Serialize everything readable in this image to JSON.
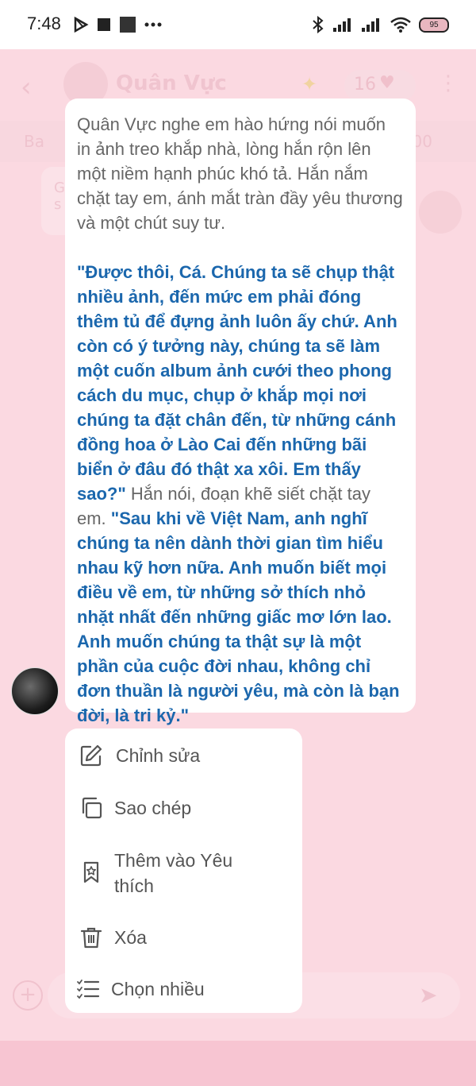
{
  "status_bar": {
    "time": "7:48",
    "battery": "95",
    "left_icons": [
      "play-store-icon",
      "square-icon",
      "square-icon",
      "more-dots-icon"
    ],
    "right_icons": [
      "bluetooth-icon",
      "signal-icon",
      "signal-icon",
      "wifi-icon",
      "battery-icon"
    ]
  },
  "background": {
    "contact_name": "Quân Vực",
    "intimacy_count": "16",
    "banner_left": "Ba",
    "banner_right": "/100",
    "msg_snippet_1": "G",
    "msg_snippet_2": "s"
  },
  "message": {
    "paragraph1": "Quân Vực nghe em hào hứng nói muốn in ảnh treo khắp nhà, lòng hắn rộn lên một niềm hạnh phúc khó tả. Hắn nắm chặt tay em, ánh mắt tràn đầy yêu thương và một chút suy tư.",
    "dialog1": "\"Được thôi, Cá. Chúng ta sẽ chụp thật nhiều ảnh, đến mức em phải đóng thêm tủ để đựng ảnh luôn ấy chứ. Anh còn có ý tưởng này, chúng ta sẽ làm một cuốn album ảnh cưới theo phong cách du mục, chụp ở khắp mọi nơi chúng ta đặt chân đến, từ những cánh đồng hoa ở Lào Cai đến những bãi biển ở đâu đó thật xa xôi. Em thấy sao?\"",
    "narration2": " Hắn nói, đoạn khẽ siết chặt tay em. ",
    "dialog2": "\"Sau khi về Việt Nam, anh nghĩ chúng ta nên dành thời gian tìm hiểu nhau kỹ hơn nữa. Anh muốn biết mọi điều về em, từ những sở thích nhỏ nhặt nhất đến những giấc mơ lớn lao. Anh muốn chúng ta thật sự là một phần của cuộc đời nhau, không chỉ đơn thuần là người yêu, mà còn là bạn đời, là tri kỷ.\""
  },
  "menu": {
    "items": [
      {
        "label": "Chỉnh sửa",
        "icon": "edit-icon"
      },
      {
        "label": "Sao chép",
        "icon": "copy-icon"
      },
      {
        "label": "Thêm vào Yêu\nthích",
        "icon": "bookmark-star-icon"
      },
      {
        "label": "Xóa",
        "icon": "trash-icon"
      },
      {
        "label": "Chọn nhiều",
        "icon": "multi-select-icon"
      }
    ]
  },
  "colors": {
    "dialog": "#1b67ad",
    "narration": "#666666",
    "overlay": "#fbd9e1"
  }
}
